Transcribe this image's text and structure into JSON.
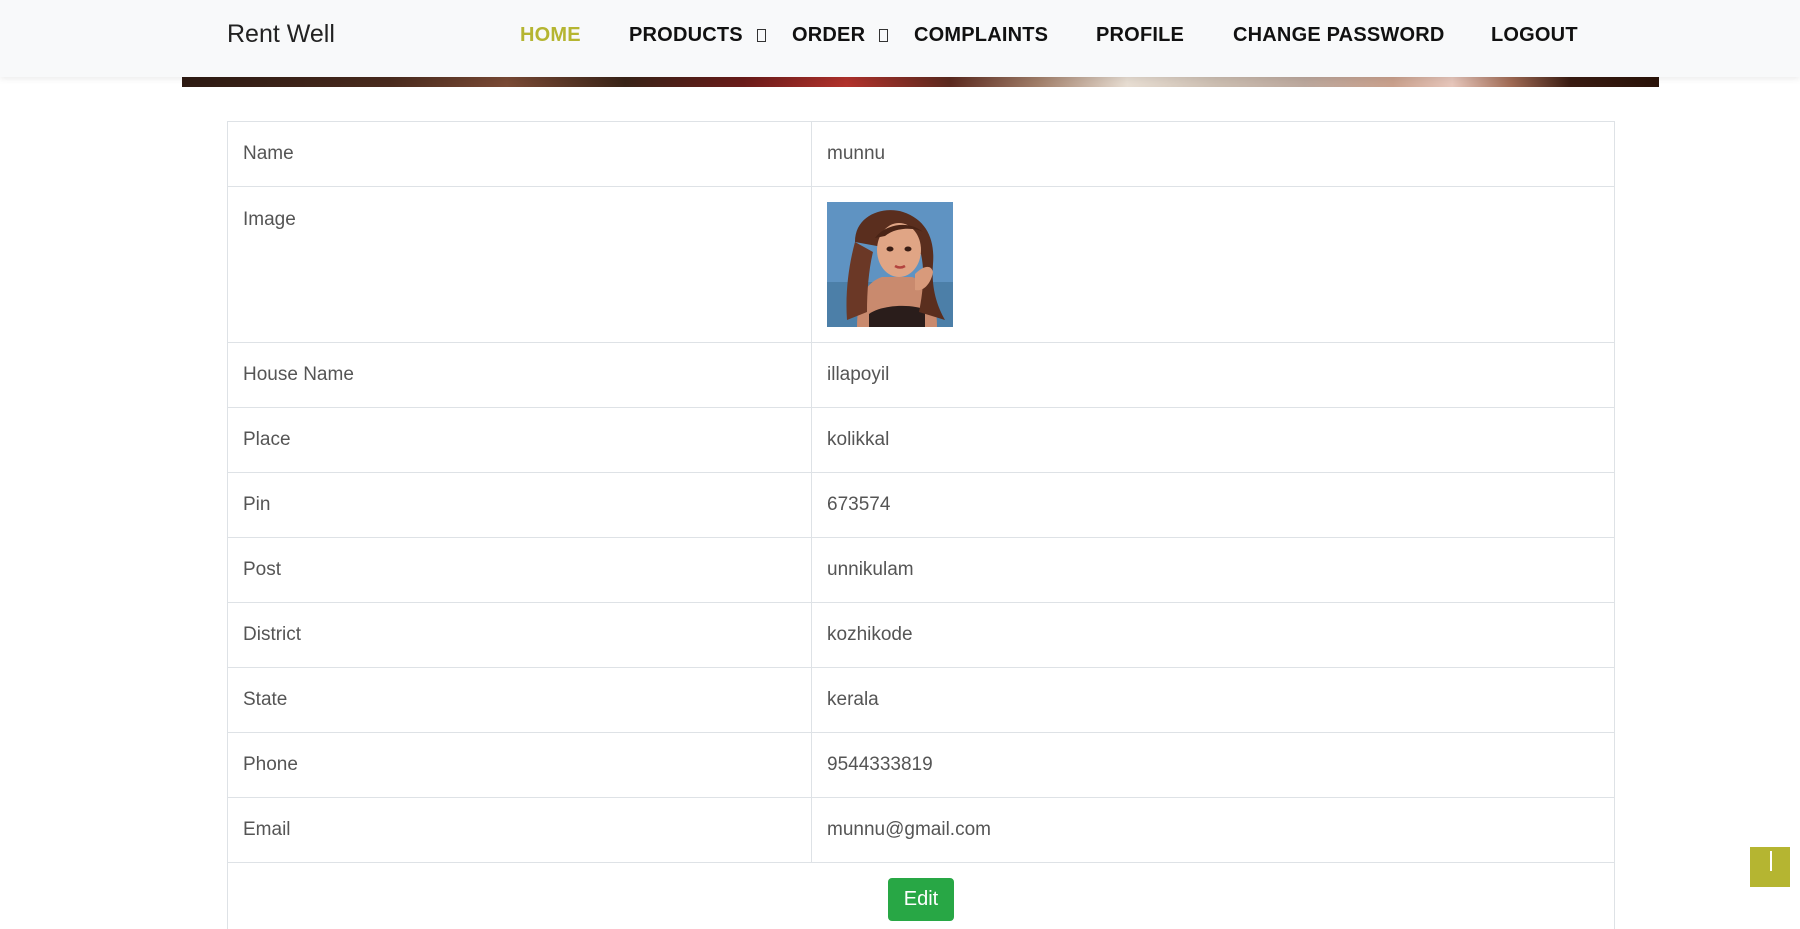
{
  "brand": "Rent Well",
  "nav": {
    "home": "HOME",
    "products": "PRODUCTS",
    "order": "ORDER",
    "complaints": "COMPLAINTS",
    "profile": "PROFILE",
    "change_password": "CHANGE PASSWORD",
    "logout": "LOGOUT"
  },
  "profile": {
    "rows": [
      {
        "label": "Name",
        "value": "munnu"
      },
      {
        "label": "Image",
        "value": ""
      },
      {
        "label": "House Name",
        "value": "illapoyil"
      },
      {
        "label": "Place",
        "value": "kolikkal"
      },
      {
        "label": "Pin",
        "value": "673574"
      },
      {
        "label": "Post",
        "value": "unnikulam"
      },
      {
        "label": "District",
        "value": "kozhikode"
      },
      {
        "label": "State",
        "value": "kerala"
      },
      {
        "label": "Phone",
        "value": "9544333819"
      },
      {
        "label": "Email",
        "value": "munnu@gmail.com"
      }
    ],
    "edit_label": "Edit"
  },
  "colors": {
    "accent": "#b5b531",
    "edit_button": "#28a745"
  },
  "icons": {
    "dropdown": "chevron-down-icon",
    "back_to_top": "arrow-up-icon"
  }
}
